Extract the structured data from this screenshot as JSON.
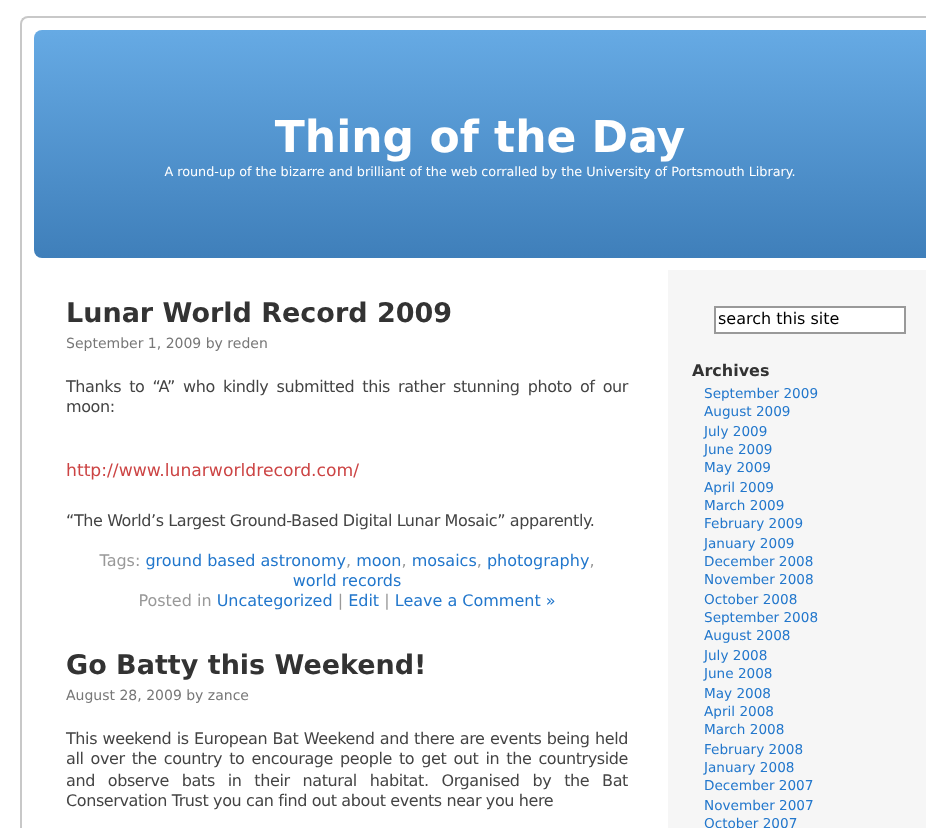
{
  "header": {
    "title": "Thing of the Day",
    "tagline": "A round-up of the bizarre and brilliant of the web corralled by the University of Portsmouth Library."
  },
  "posts": [
    {
      "title": "Lunar World Record 2009",
      "meta": "September 1, 2009 by reden",
      "blocks": [
        {
          "kind": "text",
          "text": "Thanks to “A” who kindly submitted this rather stunning photo of our moon:"
        },
        {
          "kind": "link",
          "text": "http://www.lunarworldrecord.com/"
        },
        {
          "kind": "text",
          "text": "“The World’s Largest Ground-Based Digital Lunar Mosaic” apparently."
        }
      ],
      "tags_label": "Tags:",
      "tag_separator": ",",
      "action_separator": "|",
      "tags": [
        "ground based astronomy",
        "moon",
        "mosaics",
        "photography",
        "world records"
      ],
      "posted_label": "Posted in",
      "category": "Uncategorized",
      "actions": [
        "Edit",
        "Leave a Comment »"
      ]
    },
    {
      "title": "Go Batty this Weekend!",
      "meta": "August 28, 2009 by zance",
      "blocks": [
        {
          "kind": "text",
          "text": "This weekend is European Bat Weekend and there are events being held all over the country to encourage people to get out in the countryside and observe bats in their natural habitat. Organised by the Bat Conservation Trust you can find out about events near you here"
        }
      ]
    }
  ],
  "sidebar": {
    "search": {
      "value": "search this site"
    },
    "archives_title": "Archives",
    "archives": [
      "September 2009",
      "August 2009",
      "July 2009",
      "June 2009",
      "May 2009",
      "April 2009",
      "March 2009",
      "February 2009",
      "January 2009",
      "December 2008",
      "November 2008",
      "October 2008",
      "September 2008",
      "August 2008",
      "July 2008",
      "June 2008",
      "May 2008",
      "April 2008",
      "March 2008",
      "February 2008",
      "January 2008",
      "December 2007",
      "November 2007",
      "October 2007"
    ]
  }
}
